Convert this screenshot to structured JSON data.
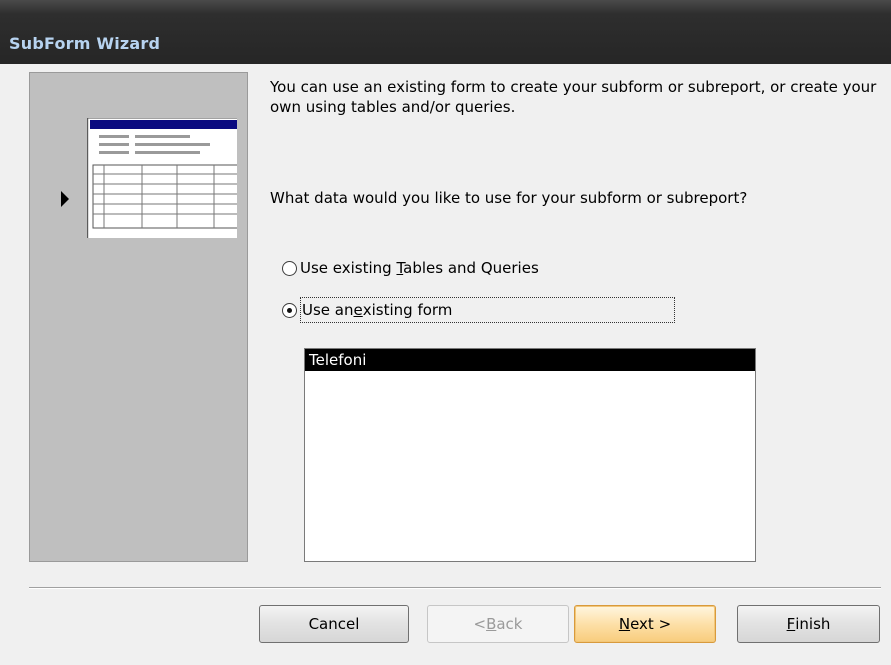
{
  "window": {
    "title": "SubForm Wizard"
  },
  "description": "You can use an existing form to create your subform or subreport, or create your own using tables and/or queries.",
  "question": "What data would you like to use for your subform or subreport?",
  "options": [
    {
      "pre": "Use existing ",
      "accel": "T",
      "post": "ables and Queries",
      "selected": false
    },
    {
      "pre": "Use an ",
      "accel": "e",
      "post": "xisting form",
      "selected": true
    }
  ],
  "forms_list": {
    "items": [
      "Telefoni"
    ],
    "selected_index": 0
  },
  "buttons": {
    "cancel": {
      "pre": "Cancel",
      "accel": "",
      "post": ""
    },
    "back": {
      "pre": "< ",
      "accel": "B",
      "post": "ack",
      "disabled": true
    },
    "next": {
      "pre": "",
      "accel": "N",
      "post": "ext >",
      "default": true
    },
    "finish": {
      "pre": "",
      "accel": "F",
      "post": "inish"
    }
  },
  "preview_icon": "subform-preview-icon",
  "colors": {
    "titlebar": "#2e2e2e",
    "title_text": "#b7d3f0",
    "selection": "#000000",
    "default_button": "#f8cc7c"
  }
}
